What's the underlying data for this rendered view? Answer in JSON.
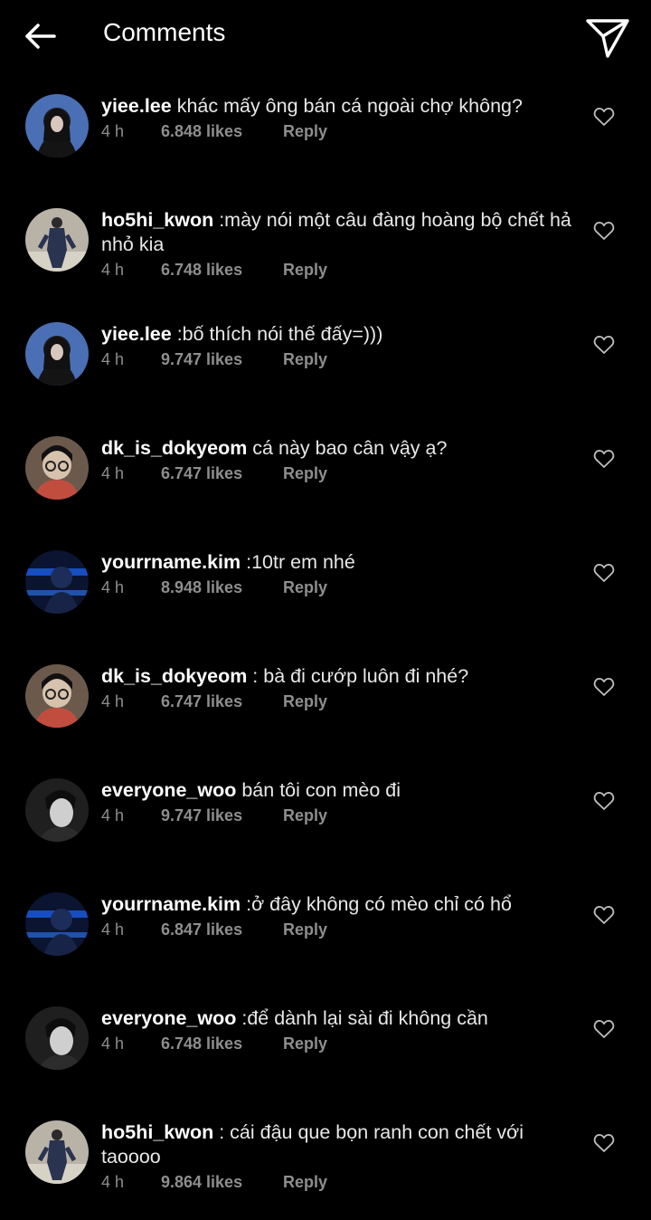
{
  "header": {
    "title": "Comments",
    "back_icon": "arrow-left-icon",
    "send_icon": "paper-plane-icon"
  },
  "colors": {
    "background": "#000000",
    "text": "#ffffff",
    "meta": "#8e8e8e"
  },
  "comments": [
    {
      "user": "yiee.lee",
      "text": " khác mấy ông bán cá ngoài chợ không?",
      "time": "4 h",
      "likes": "6.848 likes",
      "reply": "Reply",
      "avatar": "avatar-dark-hair"
    },
    {
      "user": "ho5hi_kwon",
      "text": " :mày nói một câu đàng hoàng bộ chết hả nhỏ kia",
      "time": "4 h",
      "likes": "6.748 likes",
      "reply": "Reply",
      "avatar": "avatar-suit"
    },
    {
      "user": "yiee.lee",
      "text": " :bố thích nói thế đấy=)))",
      "time": "4 h",
      "likes": "9.747 likes",
      "reply": "Reply",
      "avatar": "avatar-dark-hair"
    },
    {
      "user": "dk_is_dokyeom",
      "text": " cá này bao cân vậy ạ?",
      "time": "4 h",
      "likes": "6.747 likes",
      "reply": "Reply",
      "avatar": "avatar-glasses"
    },
    {
      "user": "yourrname.kim",
      "text": " :10tr em nhé",
      "time": "4 h",
      "likes": "8.948 likes",
      "reply": "Reply",
      "avatar": "avatar-blue-light"
    },
    {
      "user": "dk_is_dokyeom",
      "text": " : bà đi cướp luôn đi nhé?",
      "time": "4 h",
      "likes": "6.747 likes",
      "reply": "Reply",
      "avatar": "avatar-glasses"
    },
    {
      "user": "everyone_woo",
      "text": " bán tôi con mèo đi",
      "time": "4 h",
      "likes": "9.747 likes",
      "reply": "Reply",
      "avatar": "avatar-bw-portrait"
    },
    {
      "user": "yourrname.kim",
      "text": " :ở đây không có mèo chỉ có hổ",
      "time": "4 h",
      "likes": "6.847 likes",
      "reply": "Reply",
      "avatar": "avatar-blue-light"
    },
    {
      "user": "everyone_woo",
      "text": " :để dành lại sài đi không cần",
      "time": "4 h",
      "likes": "6.748 likes",
      "reply": "Reply",
      "avatar": "avatar-bw-portrait"
    },
    {
      "user": "ho5hi_kwon",
      "text": " : cái đậu que bọn ranh con chết với taoooo",
      "time": "4 h",
      "likes": "9.864 likes",
      "reply": "Reply",
      "avatar": "avatar-suit"
    }
  ]
}
